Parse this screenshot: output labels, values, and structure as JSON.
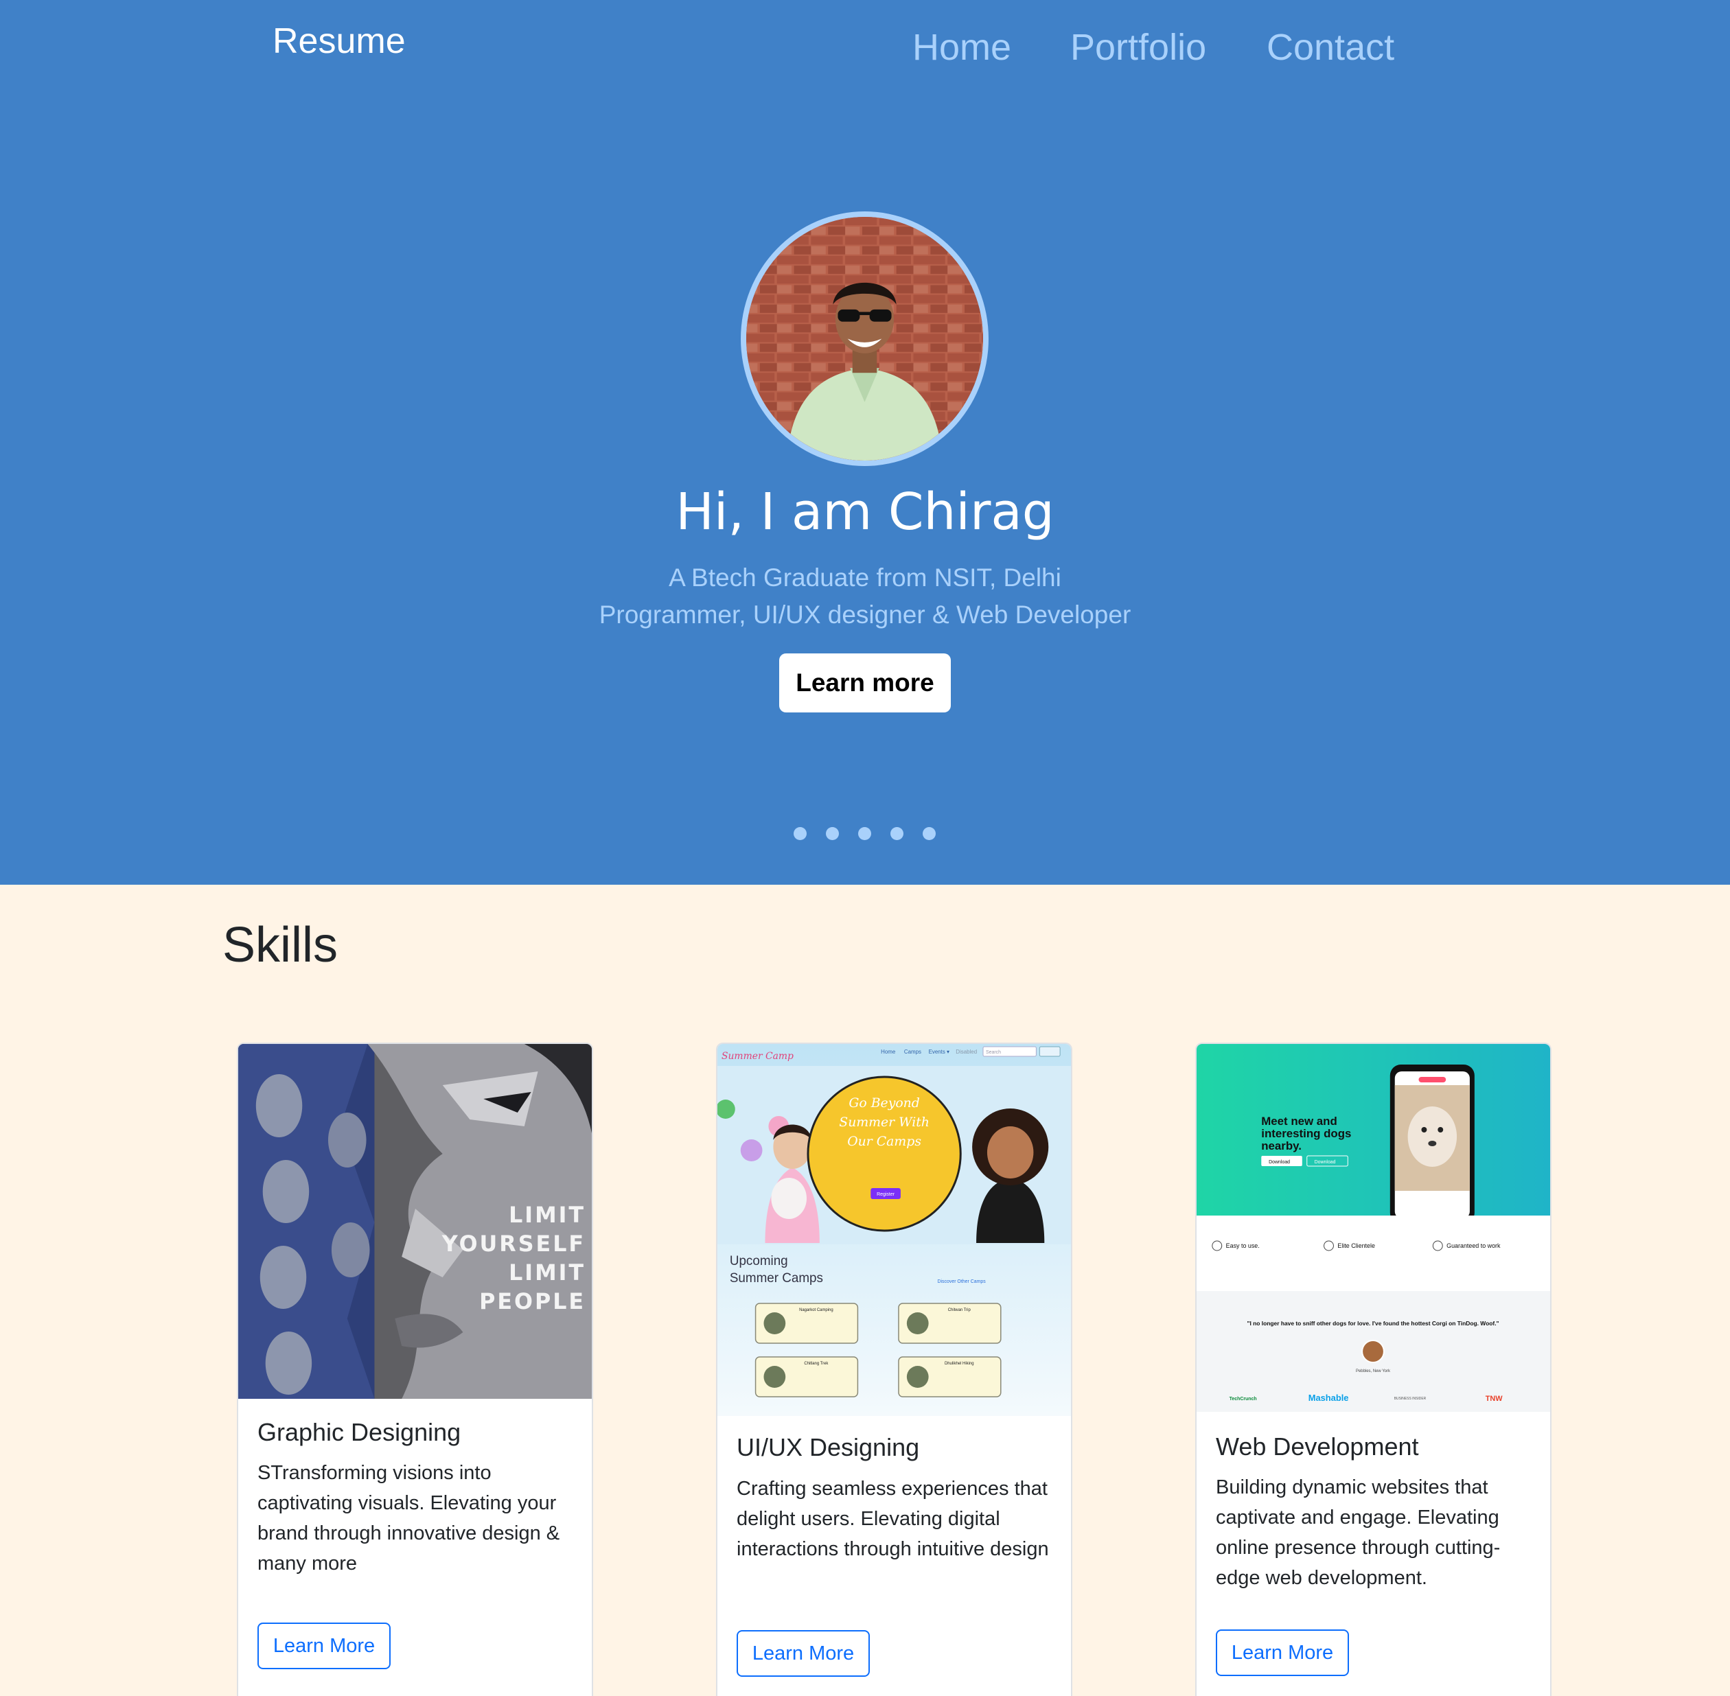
{
  "colors": {
    "hero_bg": "#4081c8",
    "nav_link": "#a9d1fb",
    "page_bg": "#fff4e6",
    "primary": "#0d6efd"
  },
  "navbar": {
    "brand": "Resume",
    "links": [
      "Home",
      "Portfolio",
      "Contact"
    ]
  },
  "hero": {
    "title": "Hi, I am Chirag",
    "subtitle_line1": "A Btech Graduate from NSIT, Delhi",
    "subtitle_line2": "Programmer, UI/UX designer & Web Developer",
    "button": "Learn more",
    "carousel_slide_count": 5
  },
  "skills": {
    "heading": "Skills",
    "cards": [
      {
        "title": "Graphic Designing",
        "text": "STransforming visions into captivating visuals. Elevating your brand through innovative design & many more",
        "button": "Learn More",
        "image_text": [
          "LIMIT",
          "YOURSELF",
          "LIMIT",
          "PEOPLE"
        ]
      },
      {
        "title": "UI/UX Designing",
        "text": "Crafting seamless experiences that delight users. Elevating digital interactions through intuitive design",
        "button": "Learn More",
        "image_text": {
          "logo": "Summer Camp",
          "nav": [
            "Home",
            "Camps",
            "Events ▾",
            "Disabled"
          ],
          "search": "Search",
          "hero": [
            "Go Beyond",
            "Summer With",
            "Our Camps"
          ],
          "register": "Register",
          "section": [
            "Upcoming",
            "Summer Camps"
          ],
          "link": "Discover Other Camps",
          "camps": [
            "Nagarkot Camping",
            "Chitwan Trip",
            "Chitlang Trek",
            "Dhulikhel Hiking"
          ]
        }
      },
      {
        "title": "Web Development",
        "text": "Building dynamic websites that captivate and engage. Elevating online presence through cutting-edge web development.",
        "button": "Learn More",
        "image_text": {
          "headline": [
            "Meet new and",
            "interesting dogs",
            "nearby."
          ],
          "download": "Download",
          "features": [
            "Easy to use.",
            "Elite Clientele",
            "Guaranteed to work"
          ],
          "quote": "\"I no longer have to sniff other dogs for love. I've found the hottest Corgi on TinDog. Woof.\"",
          "author": "Pebbles, New York",
          "press": [
            "TechCrunch",
            "Mashable",
            "BUSINESS INSIDER",
            "TNW"
          ]
        }
      }
    ]
  }
}
